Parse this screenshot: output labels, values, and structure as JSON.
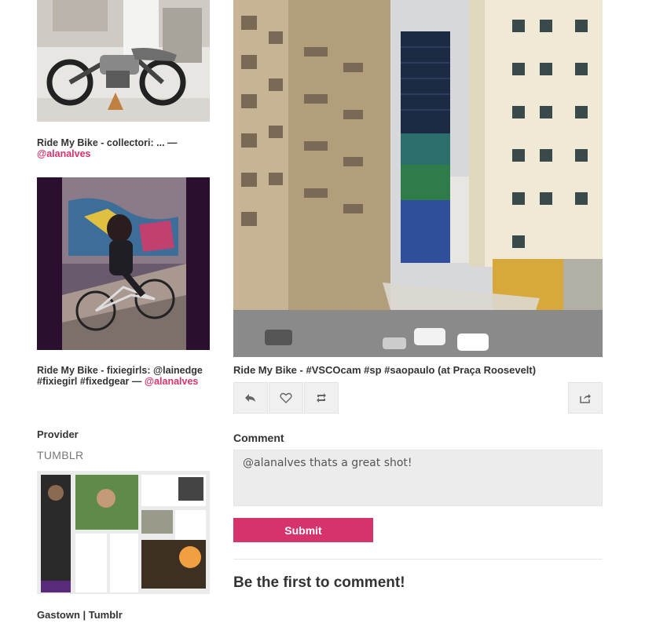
{
  "left": {
    "posts": [
      {
        "title": "Ride My Bike - collectori: ... —",
        "user": "@alanalves"
      },
      {
        "title": "Ride My Bike - fixiegirls: @lainedge #fixiegirl #fixedgear —",
        "user": "@alanalves"
      }
    ],
    "provider_label": "Provider",
    "provider_value": "TUMBLR",
    "provider_caption": "Gastown | Tumblr"
  },
  "main": {
    "caption": "Ride My Bike - #VSCOcam #sp #saopaulo (at Praça Roosevelt)",
    "actions": [
      {
        "icon": "reply-icon"
      },
      {
        "icon": "heart-icon"
      },
      {
        "icon": "reblog-icon"
      },
      {
        "icon": "share-icon"
      }
    ],
    "comment_label": "Comment",
    "comment_value": "@alanalves thats a great shot!",
    "submit_label": "Submit",
    "empty_message": "Be the first to comment!"
  },
  "colors": {
    "accent": "#d6336c",
    "button_bg": "#f0f0f0",
    "input_bg": "#ececec"
  }
}
